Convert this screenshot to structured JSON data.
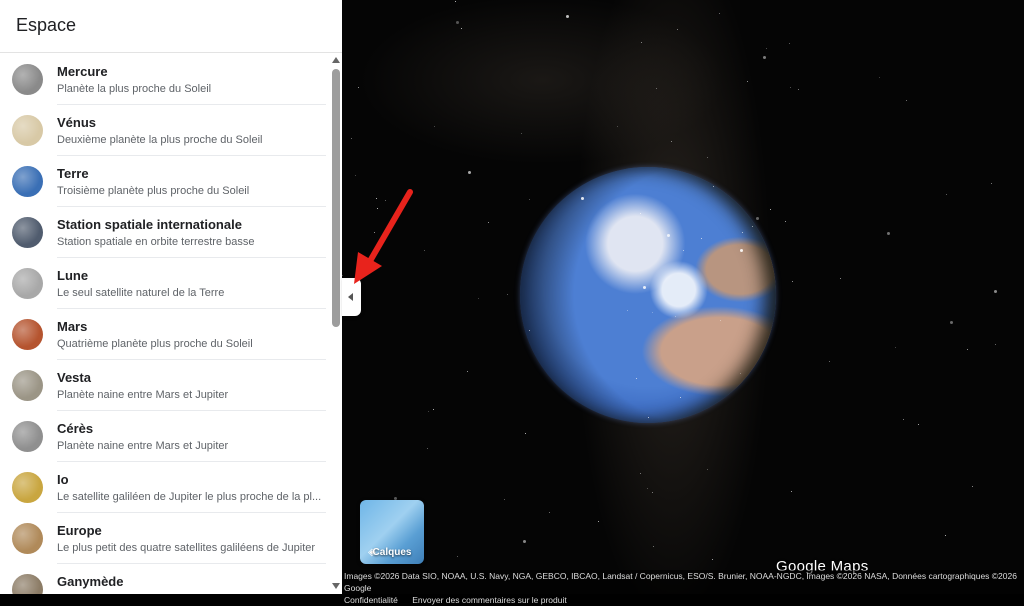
{
  "panel": {
    "title": "Espace",
    "items": [
      {
        "name": "Mercure",
        "desc": "Planète la plus proche du Soleil",
        "color": "#8a8a8a"
      },
      {
        "name": "Vénus",
        "desc": "Deuxième planète la plus proche du Soleil",
        "color": "#d8c9a6"
      },
      {
        "name": "Terre",
        "desc": "Troisième planète plus proche du Soleil",
        "color": "#3a6fb5"
      },
      {
        "name": "Station spatiale internationale",
        "desc": "Station spatiale en orbite terrestre basse",
        "color": "#505c6e"
      },
      {
        "name": "Lune",
        "desc": "Le seul satellite naturel de la Terre",
        "color": "#a8a8a8"
      },
      {
        "name": "Mars",
        "desc": "Quatrième planète plus proche du Soleil",
        "color": "#b5542f"
      },
      {
        "name": "Vesta",
        "desc": "Planète naine entre Mars et Jupiter",
        "color": "#9b9586"
      },
      {
        "name": "Cérès",
        "desc": "Planète naine entre Mars et Jupiter",
        "color": "#8f8f8f"
      },
      {
        "name": "Io",
        "desc": "Le satellite galiléen de Jupiter le plus proche de la pl...",
        "color": "#c9a640"
      },
      {
        "name": "Europe",
        "desc": "Le plus petit des quatre satellites galiléens de Jupiter",
        "color": "#b08a5a"
      },
      {
        "name": "Ganymède",
        "desc": "",
        "color": "#8c7c66"
      }
    ]
  },
  "map": {
    "layers_label": "Calques",
    "logo_text": "Google Maps",
    "attribution": "Images ©2026 Data SIO, NOAA, U.S. Navy, NGA, GEBCO, IBCAO, Landsat / Copernicus, ESO/S. Brunier, NOAA-NGDC, Images ©2026 NASA, Données cartographiques ©2026 Google",
    "privacy_link": "Confidentialité",
    "feedback_link": "Envoyer des commentaires sur le produit"
  },
  "colors": {
    "arrow": "#e8231c"
  }
}
